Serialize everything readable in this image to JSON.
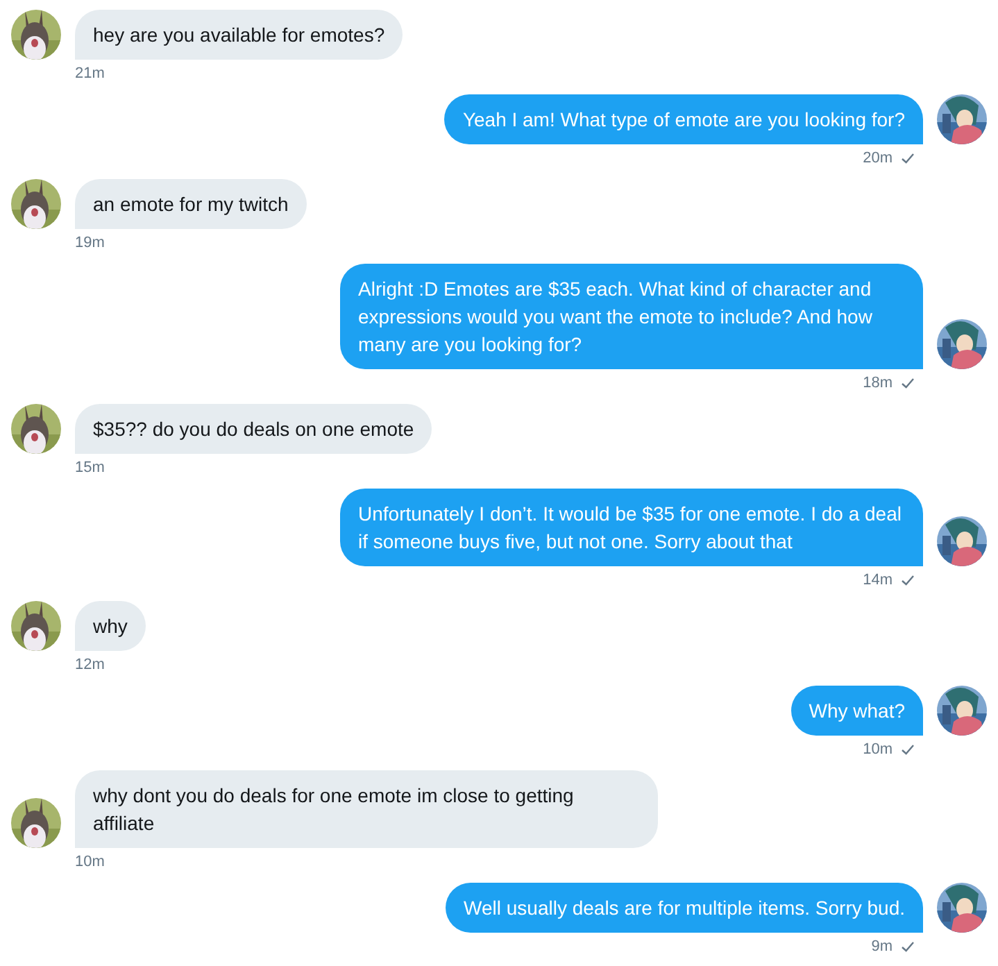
{
  "messages": [
    {
      "kind": "received",
      "text": "hey are you available for emotes?",
      "time": "21m"
    },
    {
      "kind": "sent",
      "text": "Yeah I am! What type of emote are you looking for?",
      "time": "20m"
    },
    {
      "kind": "received",
      "text": "an emote for my twitch",
      "time": "19m"
    },
    {
      "kind": "sent",
      "text": "Alright :D Emotes are $35 each. What kind of character and expressions would you want the emote to include? And how many are you looking for?",
      "time": "18m"
    },
    {
      "kind": "received",
      "text": "$35?? do you do deals on one emote",
      "time": "15m"
    },
    {
      "kind": "sent",
      "text": "Unfortunately I don’t. It would be $35 for one emote. I do a deal if someone buys five, but not one. Sorry about that",
      "time": "14m"
    },
    {
      "kind": "received",
      "text": "why",
      "time": "12m"
    },
    {
      "kind": "sent",
      "text": "Why what?",
      "time": "10m"
    },
    {
      "kind": "received",
      "text": "why dont you do deals for one emote im close to getting affiliate",
      "time": "10m"
    },
    {
      "kind": "sent",
      "text": "Well usually deals are for multiple items. Sorry bud.",
      "time": "9m"
    }
  ]
}
